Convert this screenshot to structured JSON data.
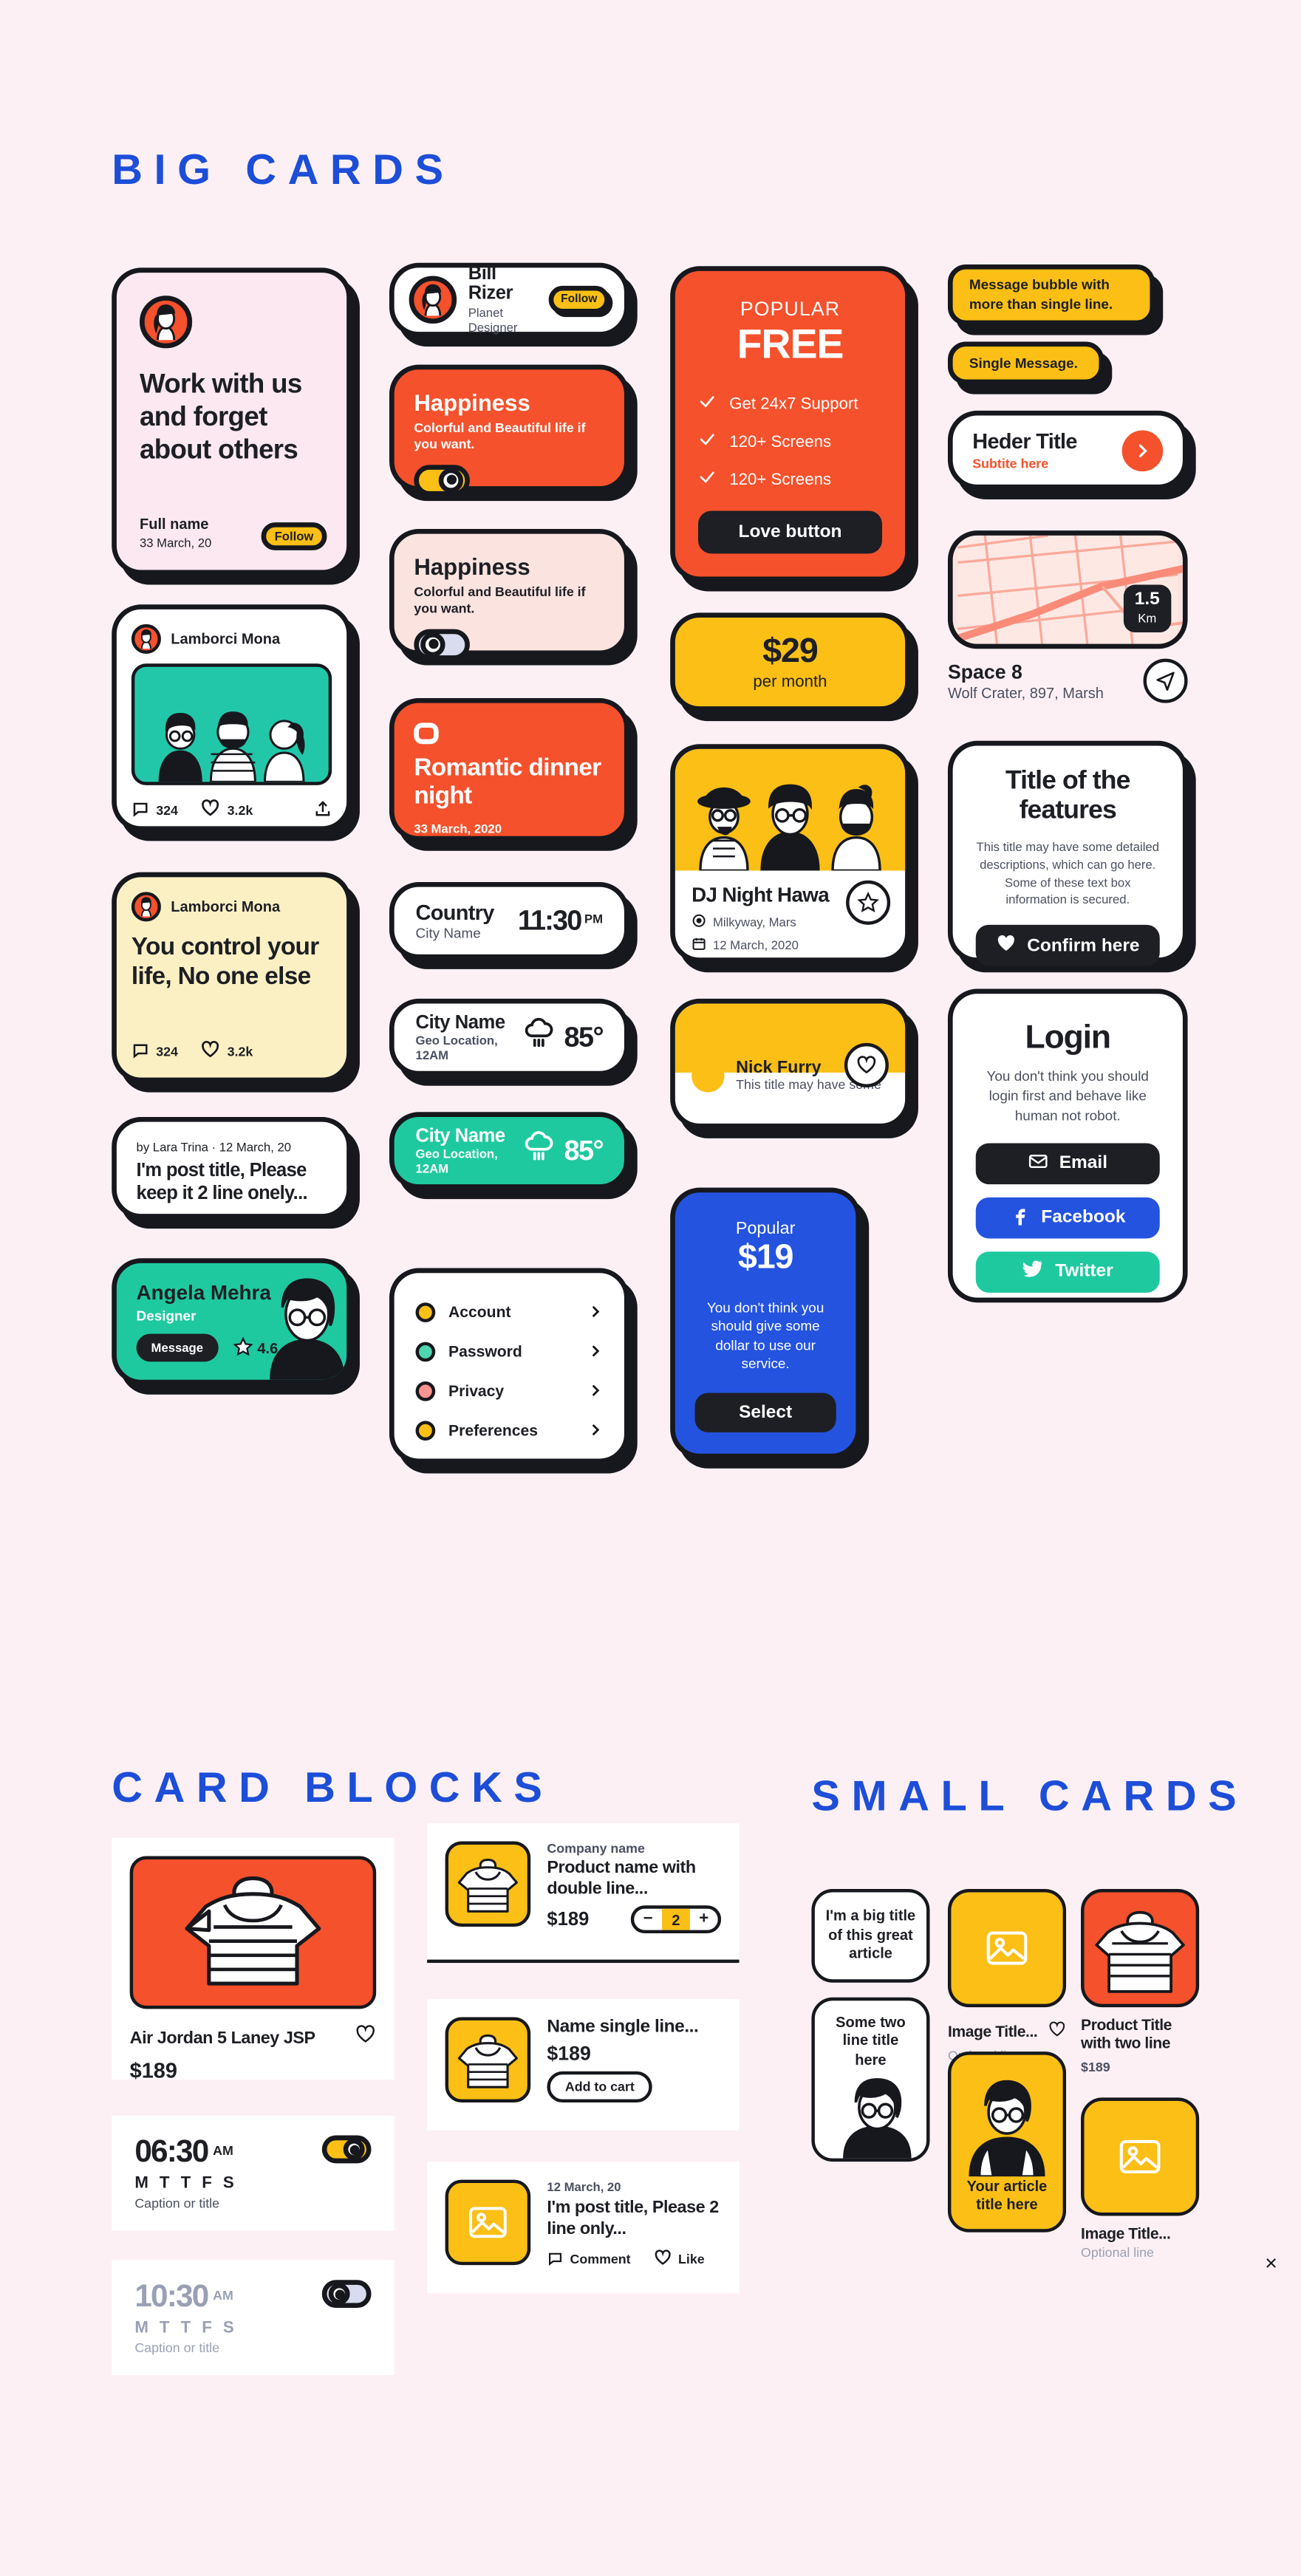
{
  "sections": {
    "big_cards": "BIG CARDS",
    "card_blocks": "CARD BLOCKS",
    "small_cards": "SMALL CARDS"
  },
  "work_card": {
    "title": "Work with us and forget about others",
    "name": "Full name",
    "date": "33 March, 20",
    "follow": "Follow"
  },
  "post_card": {
    "author": "Lamborci Mona",
    "comments": "324",
    "likes": "3.2k"
  },
  "quote_card": {
    "author": "Lamborci Mona",
    "title": "You control your life, No one else",
    "comments": "324",
    "likes": "3.2k"
  },
  "lara_card": {
    "meta": "by Lara Trina  ·  12 March, 20",
    "title": "I'm post title, Please keep it 2 line onely..."
  },
  "angela_card": {
    "name": "Angela Mehra",
    "role": "Designer",
    "message": "Message",
    "rating": "4.6"
  },
  "bill_card": {
    "name": "Bill Rizer",
    "role": "Planet Designer",
    "follow": "Follow"
  },
  "happiness_orange": {
    "title": "Happiness",
    "body": "Colorful and Beautiful life if you want."
  },
  "happiness_light": {
    "title": "Happiness",
    "body": "Colorful and Beautiful life if you want."
  },
  "romantic": {
    "title": "Romantic dinner night",
    "date": "33 March, 2020"
  },
  "country_card": {
    "country": "Country",
    "city": "City Name",
    "time": "11:30",
    "meridiem": "PM"
  },
  "weather_white": {
    "city": "City Name",
    "geo": "Geo Location, 12AM",
    "temp": "85°"
  },
  "weather_green": {
    "city": "City Name",
    "geo": "Geo Location, 12AM",
    "temp": "85°"
  },
  "settings_list": {
    "items": [
      {
        "label": "Account",
        "color": "#fbbf15"
      },
      {
        "label": "Password",
        "color": "#4ed6b0"
      },
      {
        "label": "Privacy",
        "color": "#f99490"
      },
      {
        "label": "Preferences",
        "color": "#fbbf15"
      }
    ]
  },
  "pricing_free": {
    "eyebrow": "POPULAR",
    "price": "FREE",
    "features": [
      "Get 24x7 Support",
      "120+ Screens",
      "120+ Screens"
    ],
    "button": "Love button"
  },
  "price_29": {
    "price": "$29",
    "sub": "per month"
  },
  "dj_card": {
    "title": "DJ Night Hawa",
    "place": "Milkyway, Mars",
    "date": "12 March, 2020"
  },
  "nick_card": {
    "name": "Nick Furry",
    "sub": "This title may have some"
  },
  "pricing_popular": {
    "eyebrow": "Popular",
    "price": "$19",
    "body": "You don't think you should give some dollar to use our service.",
    "button": "Select"
  },
  "bubble_multi": "Message bubble with more than single line.",
  "bubble_single": "Single Message.",
  "header_card": {
    "title": "Heder Title",
    "subtitle": "Subtite here"
  },
  "map_card": {
    "distance": "1.5",
    "unit": "Km",
    "place": "Space 8",
    "address": "Wolf Crater, 897, Marsh"
  },
  "features_card": {
    "title": "Title of the features",
    "body": "This title may have some detailed descriptions, which can go here. Some of these text box information is secured.",
    "button": "Confirm here"
  },
  "login_card": {
    "title": "Login",
    "body": "You don't think you should login first and behave like human not robot.",
    "buttons": [
      {
        "label": "Email",
        "color": "#1d1f24",
        "icon": "envelope-icon"
      },
      {
        "label": "Facebook",
        "color": "#2453e0",
        "icon": "facebook-icon"
      },
      {
        "label": "Twitter",
        "color": "#1fc9a0",
        "icon": "twitter-icon"
      }
    ]
  },
  "product_block": {
    "title": "Air Jordan 5 Laney JSP",
    "price": "$189"
  },
  "alarm_on": {
    "time": "06:30",
    "meridiem": "AM",
    "days": "M T T F S",
    "caption": "Caption or title"
  },
  "alarm_off": {
    "time": "10:30",
    "meridiem": "AM",
    "days": "M T T F S",
    "caption": "Caption or title"
  },
  "list_product_1": {
    "company": "Company name",
    "name": "Product name with double line...",
    "price": "$189",
    "qty": "2",
    "minus": "−",
    "plus": "+"
  },
  "list_product_2": {
    "name": "Name single line...",
    "price": "$189",
    "button": "Add to cart"
  },
  "list_post": {
    "date": "12 March, 20",
    "title": "I'm post title, Please 2 line only...",
    "comment": "Comment",
    "like": "Like"
  },
  "small": {
    "big_title": "I'm a big title of this great article",
    "two_line": "Some two line title here",
    "image_title_1": "Image Title...",
    "optional_1": "Optional line",
    "article_title": "Your article title here",
    "product_title": "Product Title with two line",
    "product_price": "$189",
    "image_title_2": "Image Title...",
    "optional_2": "Optional line"
  },
  "close_label": "×",
  "colors": {
    "bg": "#fdf0f5",
    "ink": "#1d1f24",
    "orange": "#f4512c",
    "yellow": "#fbbf15",
    "teal": "#1fc9a0",
    "blue": "#2453e0",
    "cream": "#fbf0c4",
    "blush": "#fbe3e0"
  }
}
